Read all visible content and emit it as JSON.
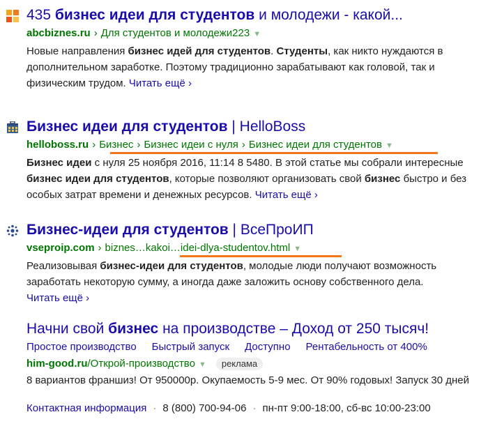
{
  "results": [
    {
      "title_num": "435 ",
      "title_bold": "бизнес идеи для студентов",
      "title_rest": " и молодежи - какой...",
      "domain": "abcbiznes.ru",
      "crumbs": [
        "Для студентов и молодежи223"
      ],
      "snippet": [
        {
          "t": "Новые направления ",
          "b": false
        },
        {
          "t": "бизнес идей для студентов",
          "b": true
        },
        {
          "t": ". ",
          "b": false
        },
        {
          "t": "Студенты",
          "b": true
        },
        {
          "t": ", как никто нуждаются в дополнительном заработке. Поэтому традиционно зарабатывают как головой, так и физическим трудом. ",
          "b": false
        }
      ],
      "more": "Читать ещё ›"
    },
    {
      "title_bold": "Бизнес идеи для студентов",
      "title_rest": " | HelloBoss",
      "domain": "helloboss.ru",
      "crumbs": [
        "Бизнес",
        "Бизнес идеи с нуля",
        "Бизнес идеи для студентов"
      ],
      "snippet": [
        {
          "t": "Бизнес идеи",
          "b": true
        },
        {
          "t": " с нуля 25 ноября 2016, 11:14 8 5480. В этой статье мы собрали интересные ",
          "b": false
        },
        {
          "t": "бизнес идеи для студентов",
          "b": true
        },
        {
          "t": ", которые позволяют организовать свой ",
          "b": false
        },
        {
          "t": "бизнес",
          "b": true
        },
        {
          "t": " быстро и без особых затрат времени и денежных ресурсов. ",
          "b": false
        }
      ],
      "more": "Читать ещё ›"
    },
    {
      "title_bold": "Бизнес-идеи для студентов",
      "title_rest": " | ВсеПроИП",
      "domain": "vseproip.com",
      "crumbs": [
        "biznes…kakoi…idei-dlya-studentov.html"
      ],
      "snippet": [
        {
          "t": "Реализовывая ",
          "b": false
        },
        {
          "t": "бизнес-идеи для студентов",
          "b": true
        },
        {
          "t": ", молодые люди получают возможность заработать некоторую сумму, а иногда даже заложить основу собственного дела. ",
          "b": false
        }
      ],
      "more": "Читать ещё ›"
    }
  ],
  "ad": {
    "title_pre": "Начни свой ",
    "title_bold": "бизнес",
    "title_rest": " на производстве – Доход от 250 тысяч!",
    "sitelinks": [
      "Простое производство",
      "Быстрый запуск",
      "Доступно",
      "Рентабельность от 400%"
    ],
    "domain": "him-good.ru",
    "path": "/Открой-производство",
    "badge": "реклама",
    "text": "8 вариантов франшиз! От 950000р. Окупаемость 5-9 мес. От 90% годовых! Запуск 30 дней",
    "contact_link": "Контактная информация",
    "phone": "8 (800) 700-94-06",
    "hours": "пн-пт 9:00-18:00, сб-вс 10:00-23:00"
  },
  "colors": {
    "link": "#1a0dab",
    "url_green": "#007700",
    "highlight_underline": "#f2771b"
  },
  "icons": {
    "r1": "orange-squares-icon",
    "r2": "briefcase-icon",
    "r3": "dots-cluster-icon",
    "triangle": "triangle-down-icon"
  }
}
